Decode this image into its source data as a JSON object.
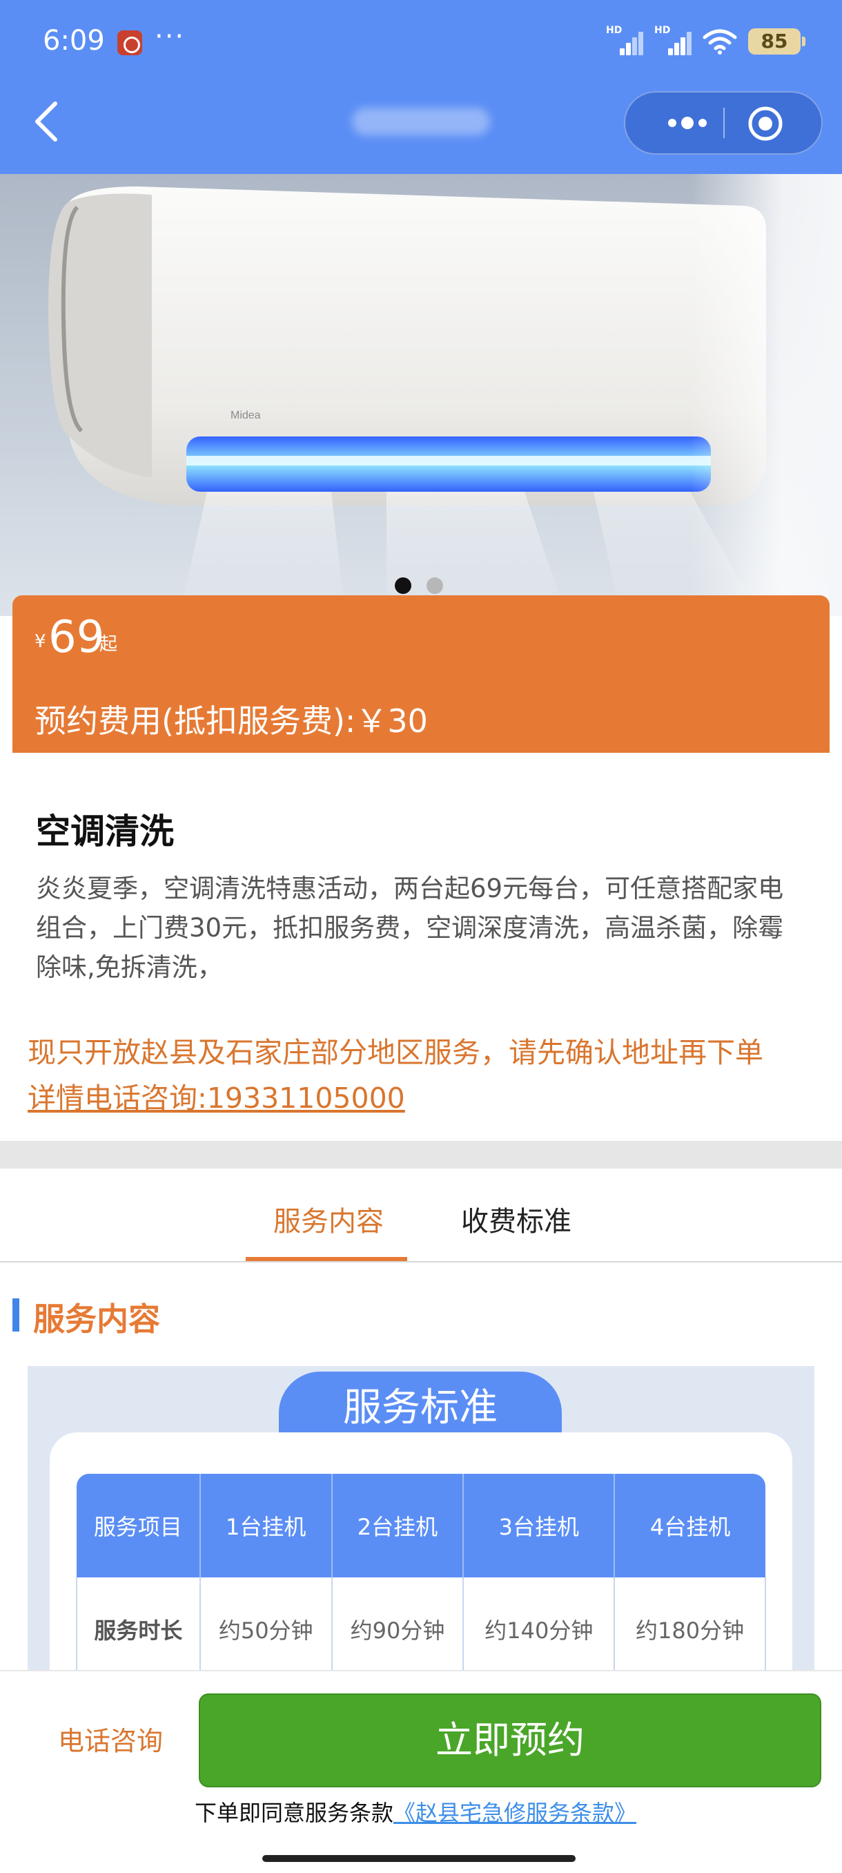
{
  "status_bar": {
    "time": "6:09",
    "more": "···",
    "battery": "85",
    "signal_label": "HD"
  },
  "nav": {
    "back_icon": "chevron-left-icon",
    "more_icon": "more-dots-icon",
    "close_icon": "target-circle-icon"
  },
  "banner": {
    "slide_count": 2,
    "active_slide": 0
  },
  "price": {
    "currency": "¥",
    "value": "69",
    "suffix": "起",
    "deposit_text": "预约费用(抵扣服务费):￥30"
  },
  "service": {
    "title": "空调清洗",
    "description": "炎炎夏季，空调清洗特惠活动，两台起69元每台，可任意搭配家电组合，上门费30元，抵扣服务费，空调深度清洗，高温杀菌，除霉除味,免拆清洗，",
    "notice": "现只开放赵县及石家庄部分地区服务，请先确认地址再下单",
    "phone_text": "详情电话咨询:19331105000"
  },
  "tabs": {
    "items": [
      {
        "label": "服务内容",
        "active": true
      },
      {
        "label": "收费标准",
        "active": false
      }
    ]
  },
  "section": {
    "title": "服务内容"
  },
  "standard": {
    "heading": "服务标准",
    "headers": [
      "服务项目",
      "1台挂机",
      "2台挂机",
      "3台挂机",
      "4台挂机"
    ],
    "rows": [
      [
        "服务时长",
        "约50分钟",
        "约90分钟",
        "约140分钟",
        "约180分钟"
      ]
    ]
  },
  "bottom": {
    "call_label": "电话咨询",
    "book_label": "立即预约",
    "agree_prefix": "下单即同意服务条款",
    "agree_link": "《赵县宅急修服务条款》"
  },
  "colors": {
    "nav_blue": "#5b8ef5",
    "accent_orange": "#e67a35",
    "book_green": "#4aa629",
    "link_blue": "#3d8ee8"
  }
}
